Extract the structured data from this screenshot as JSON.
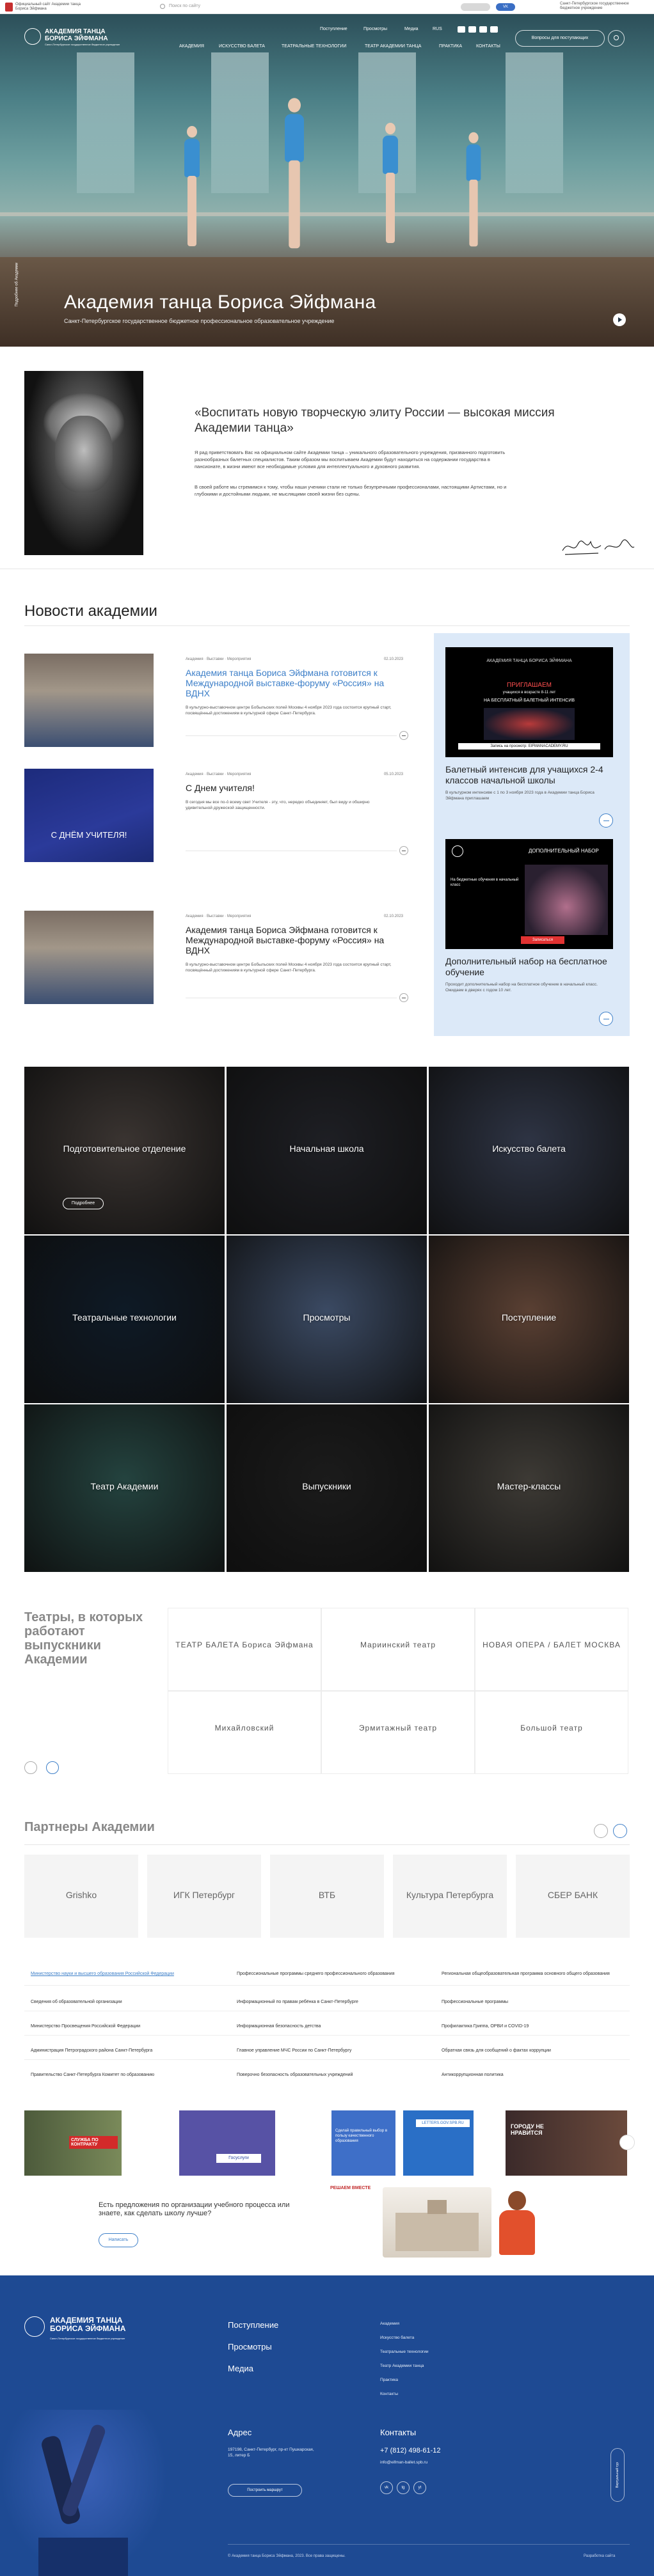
{
  "gov": {
    "left_text": "Официальный сайт Академии танца Бориса Эйфмана",
    "search_placeholder": "Поиск по сайту",
    "vk_label": "VK",
    "right_text": "Санкт-Петербургское государственное бюджетное учреждение"
  },
  "header": {
    "logo_title": "АКАДЕМИЯ ТАНЦА БОРИСА ЭЙФМАНА",
    "logo_sub": "Санкт-Петербургское государственное бюджетное учреждение",
    "top_nav": [
      "Поступление",
      "Просмотры",
      "Медиа",
      "RUS"
    ],
    "cta": "Вопросы для поступающих",
    "main_nav": [
      "АКАДЕМИЯ",
      "ИСКУССТВО БАЛЕТА",
      "ТЕАТРАЛЬНЫЕ ТЕХНОЛОГИИ",
      "ТЕАТР АКАДЕМИИ ТАНЦА",
      "ПРАКТИКА",
      "КОНТАКТЫ"
    ]
  },
  "hero": {
    "title": "Академия танца Бориса Эйфмана",
    "subtitle": "Санкт-Петербургское государственное бюджетное профессиональное образовательное учреждение",
    "vertical": "Подробнее об Академии"
  },
  "director": {
    "quote": "«Воспитать новую творческую элиту России — высокая миссия Академии танца»",
    "p1": "Я рад приветствовать Вас на официальном сайте Академии танца – уникального образовательного учреждения, призванного подготовить разнообразных балетных специалистов. Таким образом мы воспитываем Академии будут находиться на содержании государства в пансионате, в жизни имеют все необходимые условия для интеллектуального и духовного развития.",
    "p2": "В своей работе мы стремимся к тому, чтобы наши ученики стали не только безупречными профессионалами, настоящими Артистами, но и глубокими и достойными людьми, не мыслящими своей жизни без сцены.",
    "signature": "Борис Эйфман"
  },
  "news": {
    "title": "Новости академии",
    "items": [
      {
        "tags": "Академия · Выставки · Мероприятия",
        "date": "02.10.2023",
        "title": "Академия танца Бориса Эйфмана готовится к Международной выставке-форуму «Россия» на ВДНХ",
        "desc": "В культурно-выставочном центре Бобыльских полей Москвы 4 ноября 2023 года состоится крупный старт, посвящённый достижениям в культурной сфере Санкт-Петербурга.",
        "active": true
      },
      {
        "tags": "Академия · Выставки · Мероприятия",
        "date": "05.10.2023",
        "title": "С Днем учителя!",
        "desc": "В сегодня мы все по-о́ всему свет Учителя - эту, что, нередко объединяет, был виду и обширно удивительной дружеской защищенности.",
        "active": false,
        "banner": "С ДНЁМ УЧИТЕЛЯ!"
      },
      {
        "tags": "Академия · Выставки · Мероприятия",
        "date": "02.10.2023",
        "title": "Академия танца Бориса Эйфмана готовится к Международной выставке-форуму «Россия» на ВДНХ",
        "desc": "В культурно-выставочном центре Бобыльских полей Москвы 4 ноября 2023 года состоится крупный старт, посвящённый достижениям в культурной сфере Санкт-Петербурга.",
        "active": false
      }
    ],
    "side": [
      {
        "poster_head": "ПРИГЛАШАЕМ",
        "poster_sub": "учащихся в возрасте 8-11 лет",
        "poster_line": "НА БЕСПЛАТНЫЙ БАЛЕТНЫЙ ИНТЕНСИВ",
        "poster_foot": "Запись на просмотр: EIFMANACADEMY.RU",
        "title": "Балетный интенсив для учащихся 2-4 классов начальной школы",
        "desc": "В культурном интенсиве с 1 по 3 ноября 2023 года в Академии танца Бориса Эйфмана приглашаем"
      },
      {
        "poster_head": "ДОПОЛНИТЕЛЬНЫЙ НАБОР",
        "poster_sub": "На бюджетные обучения в начальный класс",
        "poster_foot": "Записаться",
        "title": "Дополнительный набор на бесплатное обучение",
        "desc": "Проходит дополнительный набор на бесплатное обучение в начальный класс. Ожидаем в дверях с годом 10 лет."
      }
    ]
  },
  "grid": [
    {
      "label": "Подготовительное отделение",
      "pill": "Подробнее",
      "bg": "#3a3431"
    },
    {
      "label": "Начальная школа",
      "bg": "#1e1f24"
    },
    {
      "label": "Искусство балета",
      "bg": "#2e3444"
    },
    {
      "label": "Театральные технологии",
      "bg": "#0e1a26"
    },
    {
      "label": "Просмотры",
      "bg": "#3b4a63"
    },
    {
      "label": "Поступление",
      "bg": "#5a4033"
    },
    {
      "label": "Театр Академии",
      "bg": "#24433f"
    },
    {
      "label": "Выпускники",
      "bg": "#1b1b1b"
    },
    {
      "label": "Мастер-классы",
      "bg": "#3d3a35"
    }
  ],
  "theatres": {
    "title": "Театры, в которых работают выпускники Академии",
    "cells": [
      "ТЕАТР БАЛЕТА Бориса Эйфмана",
      "Мариинский театр",
      "НОВАЯ ОПЕРА / БАЛЕТ МОСКВА",
      "Михайловский",
      "Эрмитажный театр",
      "Большой театр"
    ]
  },
  "partners": {
    "title": "Партнеры Академии",
    "items": [
      "Grishko",
      "ИГК Петербург",
      "ВТБ",
      "Культура Петербурга",
      "СБЕР БАНК"
    ]
  },
  "links": [
    [
      "Министерство науки и высшего образования Российской Федерации",
      "Профессиональные программы среднего профессионального образования",
      "Региональная общеобразовательная программа основного общего образования"
    ],
    [
      "Сведения об образовательной организации",
      "Информационный по правам ребёнка в Санкт-Петербурге",
      "Профессиональные программы"
    ],
    [
      "Министерство Просвещения Российской Федерации",
      "Информационная безопасность детства",
      "Профилактика Гриппа, ОРВИ и COVID-19"
    ],
    [
      "Администрация Петроградского района Санкт-Петербурга",
      "Главное управление МЧС России по Санкт-Петербургу",
      "Обратная связь для сообщений о фактах коррупции"
    ],
    [
      "Правительство Санкт-Петербурга Комитет по образованию",
      "Поверочно безопасность образовательных учреждений",
      "Антикоррупционная политика"
    ]
  ],
  "banners": [
    {
      "text": "СЛУЖБА ПО КОНТРАКТУ",
      "bg": "#5c6b47"
    },
    {
      "text": "Госуслуги",
      "bg": "#5752a5"
    },
    {
      "text": "Сделай правильный выбор в пользу качественного образования",
      "bg": "#3e6fc8"
    },
    {
      "text": "LETTERS.GOV.SPB.RU",
      "bg": "#2a6fc6"
    },
    {
      "text": "ГОРОДУ НЕ НРАВИТСЯ",
      "bg": "#3b2a2a"
    }
  ],
  "school": {
    "question": "Есть предложения по организации учебного процесса или знаете, как сделать школу лучше?",
    "button": "Написать",
    "brand": "РЕШАЕМ ВМЕСТЕ"
  },
  "footer": {
    "logo_title": "АКАДЕМИЯ ТАНЦА БОРИСА ЭЙФМАНА",
    "logo_sub": "Санкт-Петербургское государственное бюджетное учреждение",
    "nav": [
      "Поступление",
      "Просмотры",
      "Медиа"
    ],
    "nav2": [
      "Академия",
      "Искусство балета",
      "Театральные технологии",
      "Театр Академии танца",
      "Практика",
      "Контакты"
    ],
    "addr_head": "Адрес",
    "addr": "197198, Санкт-Петербург, пр-кт Пушкарская, 15, литер Б",
    "contacts_head": "Контакты",
    "phone": "+7 (812) 498-61-12",
    "email": "info@eifman-ballet.spb.ru",
    "addr_button": "Построить маршрут",
    "social": [
      "vk",
      "tg",
      "yt"
    ],
    "copyright": "© Академия танца Бориса Эйфмана, 2023. Все права защищены.",
    "credit": "Разработка сайта",
    "tour": "Виртуальный тур"
  }
}
